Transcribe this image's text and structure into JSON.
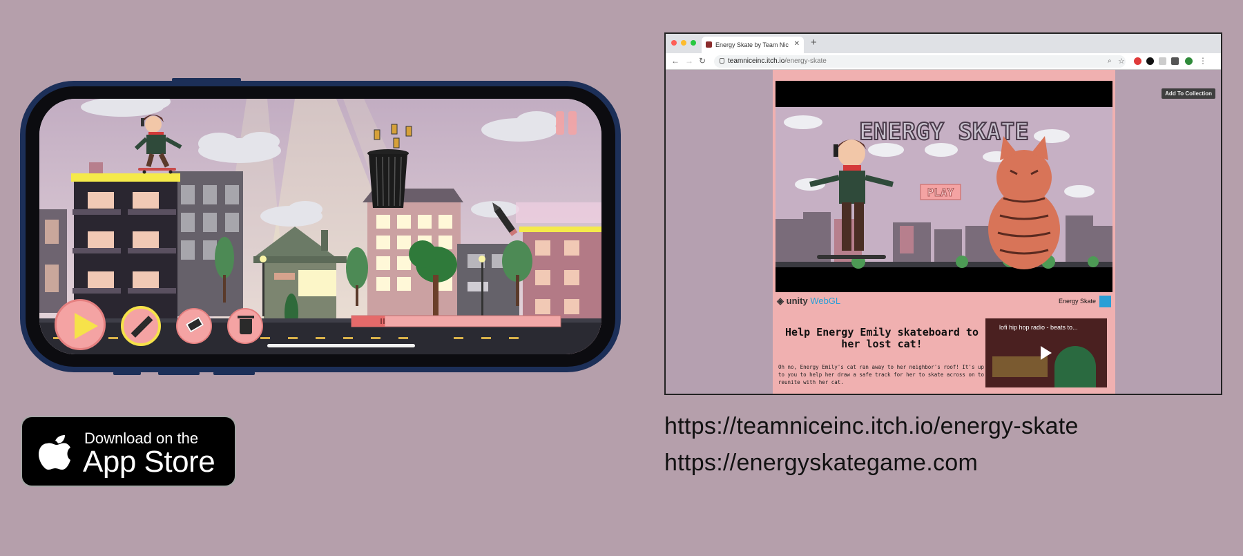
{
  "phone": {
    "controls": [
      "play",
      "pencil",
      "eraser",
      "trash"
    ],
    "progress": 0.16
  },
  "appstore": {
    "line1": "Download on the",
    "line2": "App Store"
  },
  "browser": {
    "tab_title": "Energy Skate by Team Nic",
    "url_host": "teamniceinc.itch.io",
    "url_path": "/energy-skate",
    "add_to_collection": "Add To Collection",
    "game": {
      "title": "ENERGY SKATE",
      "play_label": "PLAY"
    },
    "unity_brand": "unity",
    "unity_webgl": "WebGL",
    "unity_game_name": "Energy Skate",
    "description_title": "Help Energy Emily skateboard to her lost cat!",
    "description_body": "Oh no, Energy Emily's cat ran away to her neighbor's roof! It's up to you to help her draw a safe track for her to skate across on to reunite with her cat.",
    "video_title": "lofi hip hop radio - beats to..."
  },
  "links": [
    "https://teamniceinc.itch.io/energy-skate",
    "https://energyskategame.com"
  ],
  "colors": {
    "background": "#b59fab",
    "phone_frame": "#1c2f58",
    "itch_page": "#f0b0b0",
    "button_pink": "#f4a3a3",
    "accent_yellow": "#f6e24a"
  }
}
